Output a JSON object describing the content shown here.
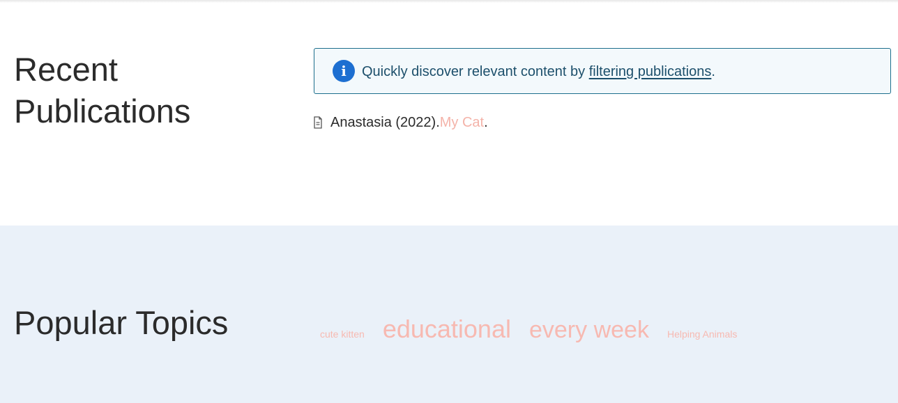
{
  "recent_publications": {
    "title": "Recent Publications",
    "info": {
      "icon": "info-icon",
      "text_before": "Quickly discover relevant content by ",
      "link_text": "filtering publications",
      "text_after": "."
    },
    "publication": {
      "icon": "document-icon",
      "author_year": "Anastasia (2022). ",
      "title": "My Cat",
      "suffix": "."
    }
  },
  "popular_topics": {
    "title": "Popular Topics",
    "tags": [
      "cute kitten",
      "educational",
      "every week",
      "Helping Animals"
    ]
  },
  "colors": {
    "link_pink": "#f4b3a9",
    "info_blue": "#1d6fd1",
    "topics_bg": "#eaf1f9"
  }
}
